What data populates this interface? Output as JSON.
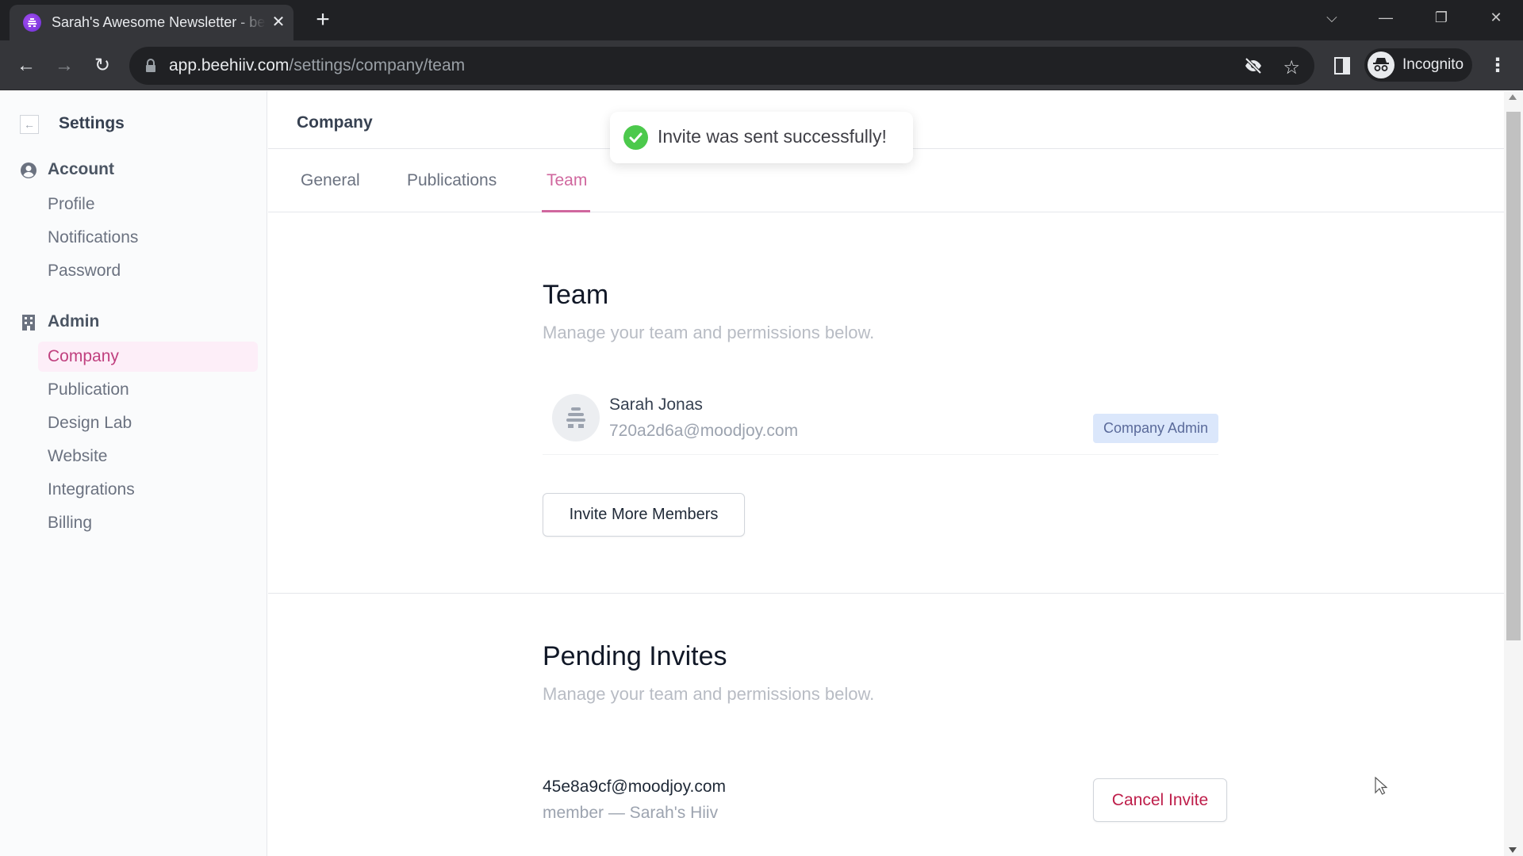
{
  "browser": {
    "tab_title": "Sarah's Awesome Newsletter - beehiiv",
    "tab_close": "✕",
    "new_tab": "+",
    "url_domain": "app.beehiiv.com",
    "url_path": "/settings/company/team",
    "profile_label": "Incognito",
    "window_controls": {
      "tab_search": "⌵",
      "minimize": "—",
      "restore": "❐",
      "close": "✕"
    }
  },
  "toast": {
    "message": "Invite was sent successfully!",
    "status": "success",
    "color": "#4cc94c"
  },
  "sidebar": {
    "back_icon": "←",
    "title": "Settings",
    "groups": [
      {
        "label": "Account",
        "icon": "user-circle-icon",
        "items": [
          {
            "label": "Profile",
            "active": false
          },
          {
            "label": "Notifications",
            "active": false
          },
          {
            "label": "Password",
            "active": false
          }
        ]
      },
      {
        "label": "Admin",
        "icon": "building-icon",
        "items": [
          {
            "label": "Company",
            "active": true
          },
          {
            "label": "Publication",
            "active": false
          },
          {
            "label": "Design Lab",
            "active": false
          },
          {
            "label": "Website",
            "active": false
          },
          {
            "label": "Integrations",
            "active": false
          },
          {
            "label": "Billing",
            "active": false
          }
        ]
      }
    ]
  },
  "main": {
    "header_title": "Company",
    "tabs": [
      {
        "label": "General",
        "active": false
      },
      {
        "label": "Publications",
        "active": false
      },
      {
        "label": "Team",
        "active": true
      }
    ],
    "team": {
      "title": "Team",
      "subtitle": "Manage your team and permissions below.",
      "members": [
        {
          "name": "Sarah Jonas",
          "email": "720a2d6a@moodjoy.com",
          "role": "Company Admin"
        }
      ],
      "invite_button": "Invite More Members"
    },
    "pending": {
      "title": "Pending Invites",
      "subtitle": "Manage your team and permissions below.",
      "invites": [
        {
          "email": "45e8a9cf@moodjoy.com",
          "meta": "member — Sarah's Hiiv",
          "cancel_label": "Cancel Invite"
        }
      ]
    }
  },
  "colors": {
    "accent": "#d0679e",
    "active_sidebar_bg": "#fdeef8",
    "badge_bg": "#dbe7fb",
    "danger": "#be1e4a"
  }
}
